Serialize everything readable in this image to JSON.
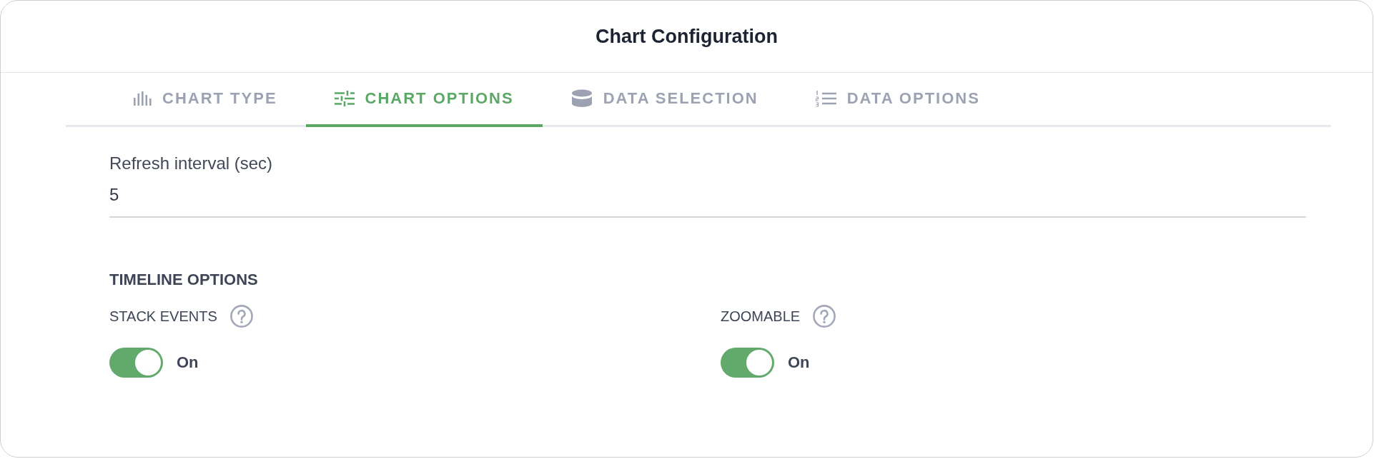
{
  "dialog": {
    "title": "Chart Configuration"
  },
  "tabs": [
    {
      "label": "CHART TYPE",
      "kind": "bars",
      "selected": false
    },
    {
      "label": "CHART OPTIONS",
      "kind": "sliders",
      "selected": true
    },
    {
      "label": "DATA SELECTION",
      "kind": "database",
      "selected": false
    },
    {
      "label": "DATA OPTIONS",
      "kind": "list",
      "selected": false
    }
  ],
  "refresh_interval": {
    "label": "Refresh interval (sec)",
    "value": "5"
  },
  "timeline_options": {
    "heading": "TIMELINE OPTIONS",
    "options": [
      {
        "label": "STACK EVENTS",
        "on": true,
        "state_label": "On"
      },
      {
        "label": "ZOOMABLE",
        "on": true,
        "state_label": "On"
      }
    ]
  }
}
